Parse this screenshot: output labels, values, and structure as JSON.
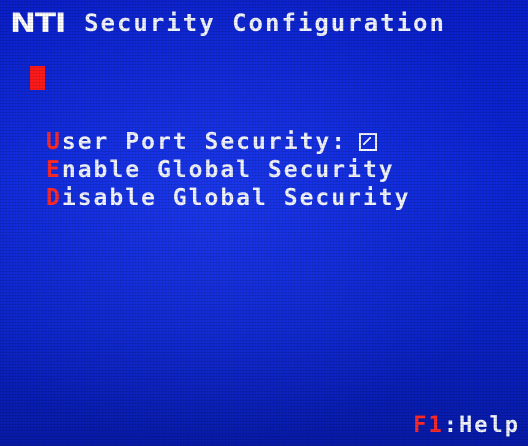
{
  "header": {
    "logo_text": "NTI",
    "title": "Security Configuration"
  },
  "menu": {
    "items": [
      {
        "hotkey": "U",
        "label": "ser Port Security:",
        "has_checkbox": true
      },
      {
        "hotkey": "E",
        "label": "nable Global Security"
      },
      {
        "hotkey": "D",
        "label": "isable Global Security"
      }
    ]
  },
  "footer": {
    "help_key": "F1",
    "help_label": ":Help"
  },
  "colors": {
    "background": "#0b26d6",
    "text": "#f4f6ff",
    "hotkey": "#ff2a2a",
    "cursor": "#ff1a1a"
  }
}
